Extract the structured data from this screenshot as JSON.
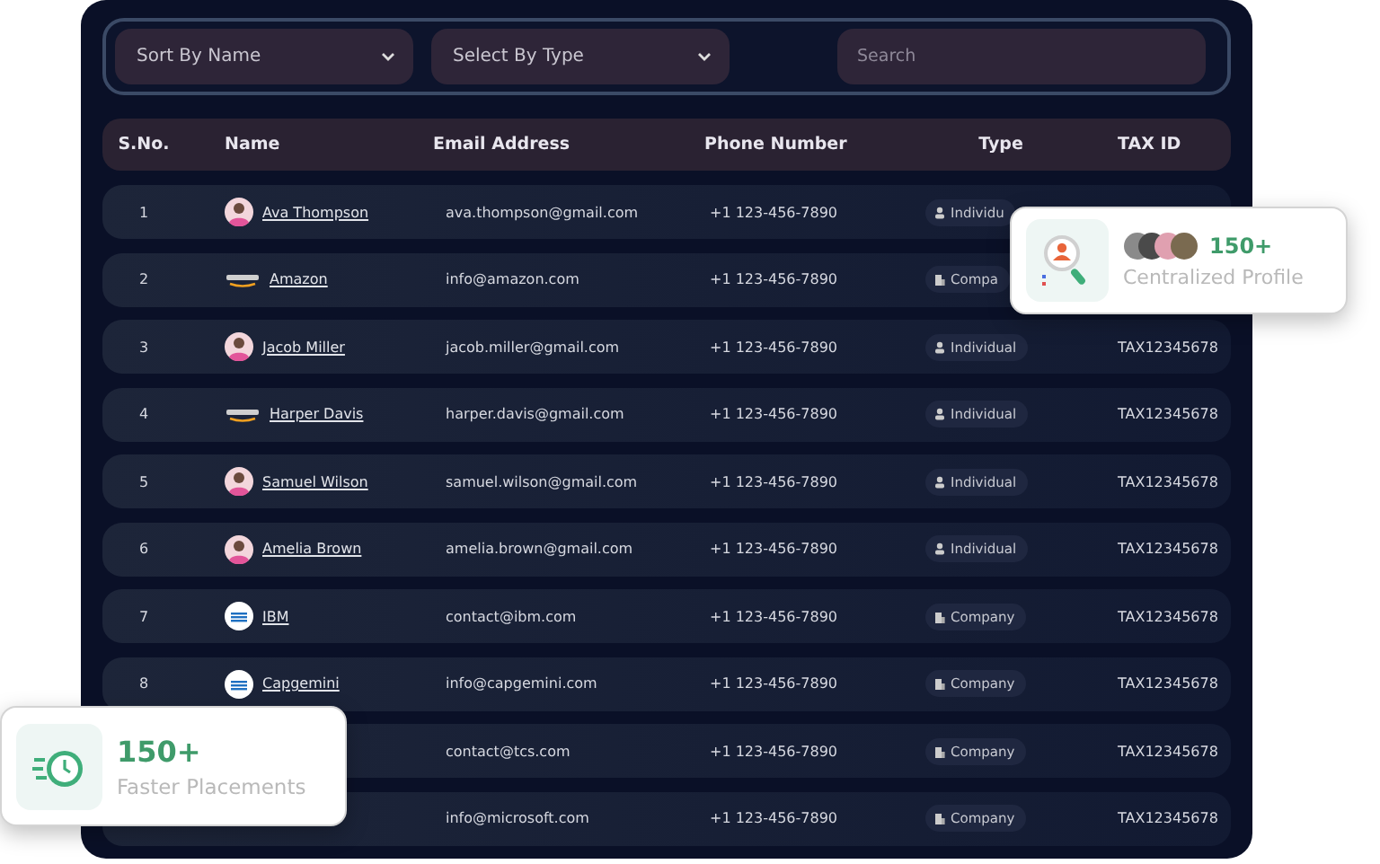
{
  "filters": [
    {
      "label": "Sort By Name"
    },
    {
      "label": "Select By Type"
    }
  ],
  "search": {
    "placeholder": "Search"
  },
  "columns": [
    "S.No.",
    "Name",
    "Email Address",
    "Phone Number",
    "Type",
    "TAX ID"
  ],
  "rows": [
    {
      "sno": "1",
      "name": "Ava Thompson",
      "avatar": {
        "kind": "person"
      },
      "email": "ava.thompson@gmail.com",
      "phone": "+1 123-456-7890",
      "type": {
        "kind": "individual",
        "label": "Individu"
      }
    },
    {
      "sno": "2",
      "name": "Amazon",
      "avatar": {
        "kind": "wordmark"
      },
      "email": "info@amazon.com",
      "phone": "+1 123-456-7890",
      "type": {
        "kind": "company",
        "label": "Compa"
      }
    },
    {
      "sno": "3",
      "name": "Jacob Miller",
      "avatar": {
        "kind": "person"
      },
      "email": "jacob.miller@gmail.com",
      "phone": "+1 123-456-7890",
      "type": {
        "kind": "individual",
        "label": "Individual"
      },
      "tax_id": "TAX12345678"
    },
    {
      "sno": "4",
      "name": "Harper Davis",
      "avatar": {
        "kind": "wordmark"
      },
      "email": "harper.davis@gmail.com",
      "phone": "+1 123-456-7890",
      "type": {
        "kind": "individual",
        "label": "Individual"
      },
      "tax_id": "TAX12345678"
    },
    {
      "sno": "5",
      "name": "Samuel Wilson",
      "avatar": {
        "kind": "person"
      },
      "email": "samuel.wilson@gmail.com",
      "phone": "+1 123-456-7890",
      "type": {
        "kind": "individual",
        "label": "Individual"
      },
      "tax_id": "TAX12345678"
    },
    {
      "sno": "6",
      "name": "Amelia Brown",
      "avatar": {
        "kind": "person"
      },
      "email": "amelia.brown@gmail.com",
      "phone": "+1 123-456-7890",
      "type": {
        "kind": "individual",
        "label": "Individual"
      },
      "tax_id": "TAX12345678"
    },
    {
      "sno": "7",
      "name": "IBM",
      "avatar": {
        "kind": "round-logo"
      },
      "email": "contact@ibm.com",
      "phone": "+1 123-456-7890",
      "type": {
        "kind": "company",
        "label": "Company"
      },
      "tax_id": "TAX12345678"
    },
    {
      "sno": "8",
      "name": "Capgemini",
      "avatar": {
        "kind": "round-logo"
      },
      "email": "info@capgemini.com",
      "phone": "+1 123-456-7890",
      "type": {
        "kind": "company",
        "label": "Company"
      },
      "tax_id": "TAX12345678"
    },
    {
      "email": "contact@tcs.com",
      "phone": "+1 123-456-7890",
      "type": {
        "kind": "company",
        "label": "Company"
      },
      "tax_id": "TAX12345678"
    },
    {
      "email": "info@microsoft.com",
      "phone": "+1 123-456-7890",
      "type": {
        "kind": "company",
        "label": "Company"
      },
      "tax_id": "TAX12345678"
    }
  ],
  "profile_card": {
    "count": "150+",
    "label": "Centralized Profile"
  },
  "placements_card": {
    "count": "150+",
    "label": "Faster Placements"
  }
}
